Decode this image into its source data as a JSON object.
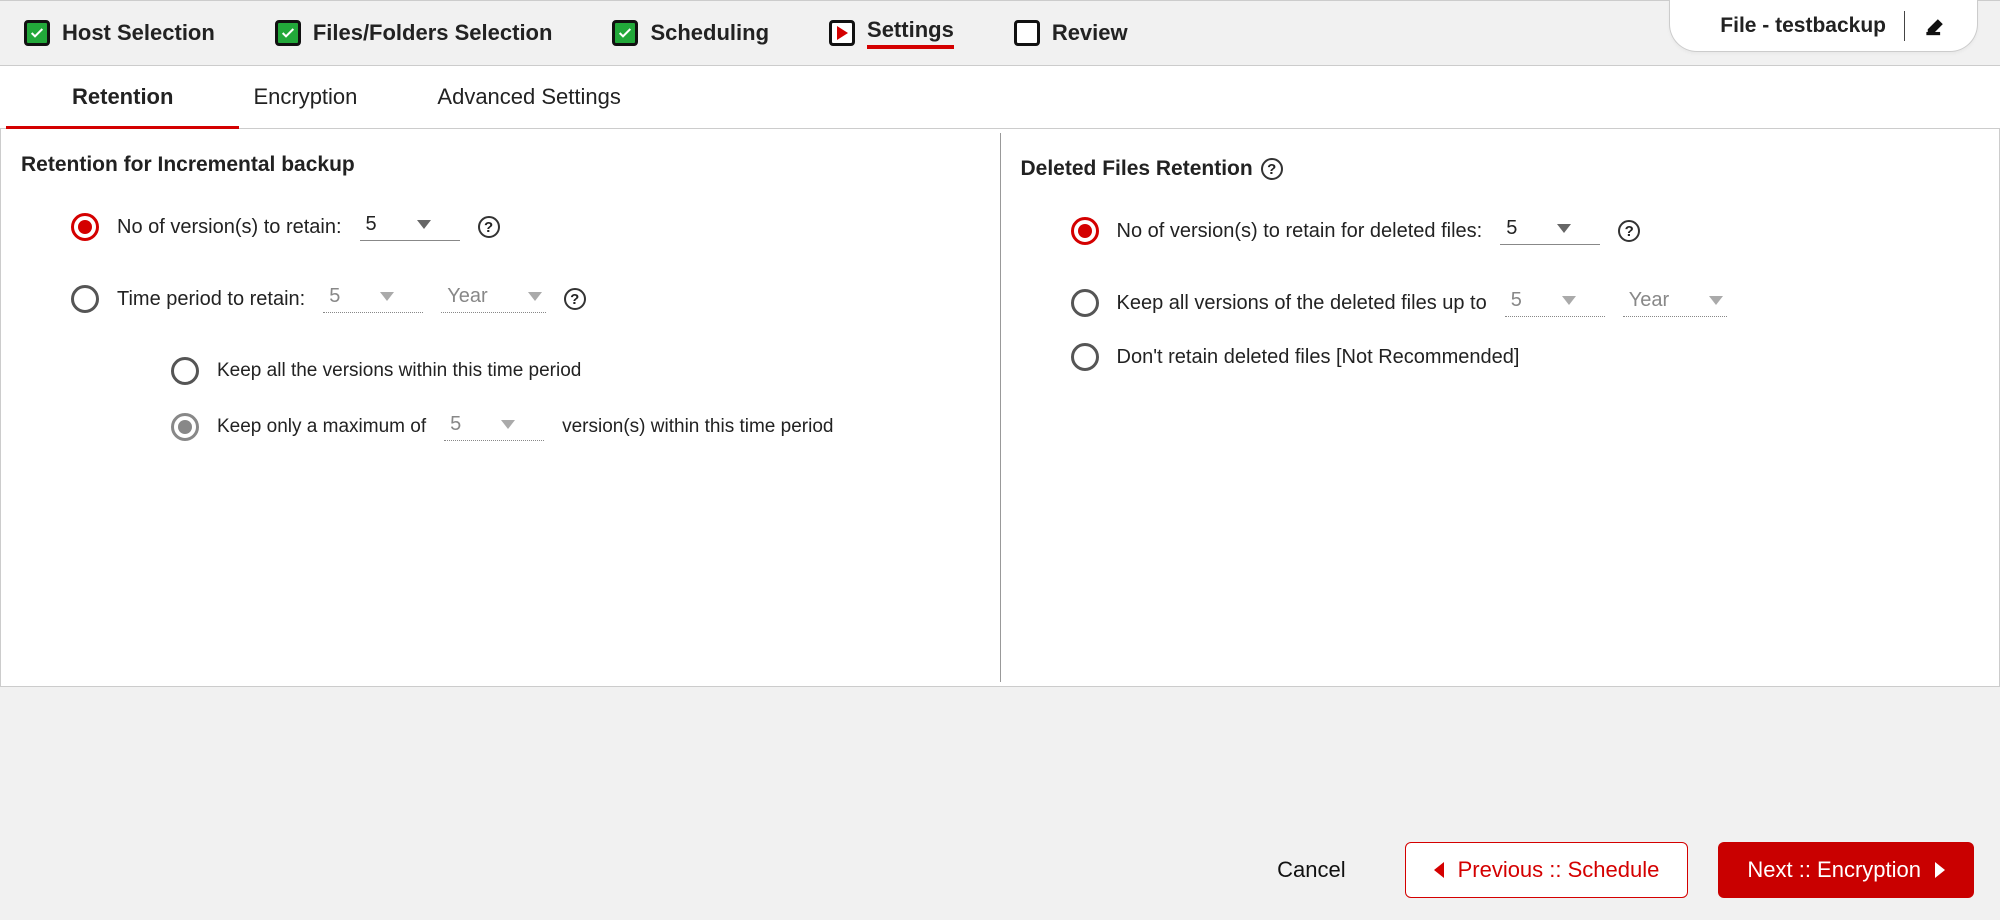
{
  "info": {
    "title": "File - testbackup"
  },
  "steps": {
    "host": "Host Selection",
    "files": "Files/Folders Selection",
    "schedule": "Scheduling",
    "settings": "Settings",
    "review": "Review"
  },
  "subtabs": {
    "retention": "Retention",
    "encryption": "Encryption",
    "advanced": "Advanced Settings"
  },
  "left": {
    "title": "Retention for Incremental backup",
    "opt1_label": "No of version(s) to retain:",
    "opt1_value": "5",
    "opt2_label": "Time period to retain:",
    "opt2_value": "5",
    "opt2_unit": "Year",
    "opt2a_label": "Keep all the versions within this time period",
    "opt2b_prefix": "Keep only a maximum of",
    "opt2b_value": "5",
    "opt2b_suffix": "version(s) within this time period"
  },
  "right": {
    "title": "Deleted Files Retention",
    "opt1_label": "No of version(s) to retain for deleted files:",
    "opt1_value": "5",
    "opt2_label": "Keep all versions of the deleted files up to",
    "opt2_value": "5",
    "opt2_unit": "Year",
    "opt3_label": "Don't retain deleted files [Not Recommended]"
  },
  "footer": {
    "cancel": "Cancel",
    "prev": "Previous :: Schedule",
    "next": "Next :: Encryption"
  }
}
